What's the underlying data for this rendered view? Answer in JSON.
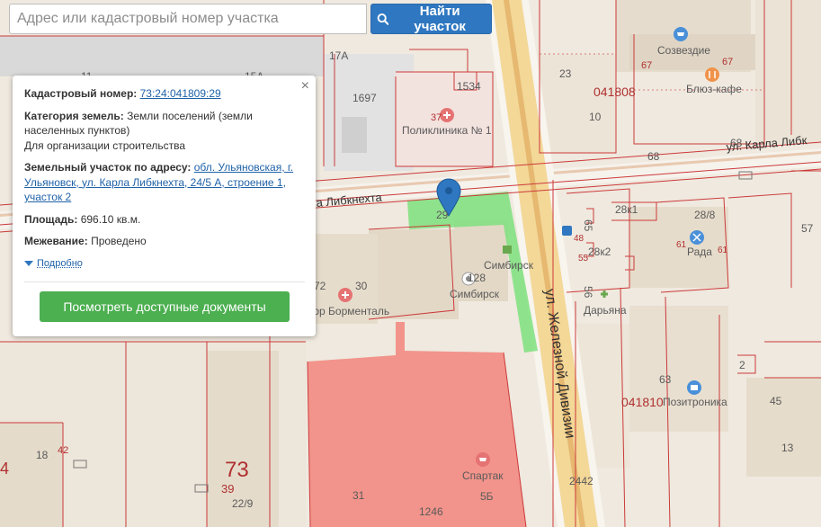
{
  "search": {
    "placeholder": "Адрес или кадастровый номер участка",
    "button_label": "Найти участок"
  },
  "popup": {
    "cadastral_label": "Кадастровый номер:",
    "cadastral_value": "73:24:041809:29",
    "category_label": "Категория земель:",
    "category_value": "Земли поселений (земли населенных пунктов)",
    "category_use": "Для организации строительства",
    "address_label": "Земельный участок по адресу:",
    "address_value": "обл. Ульяновская, г. Ульяновск, ул. Карла Либкнехта, 24/5 А, строение 1, участок 2",
    "area_label": "Площадь:",
    "area_value": "696.10 кв.м.",
    "survey_label": "Межевание:",
    "survey_value": "Проведено",
    "details_toggle": "Подробно",
    "docs_button": "Посмотреть доступные документы",
    "close_symbol": "×"
  },
  "map": {
    "streets": {
      "libknekhta_left": "а Либкнехта",
      "libknekhta_right": "ул. Карла Либк",
      "zheleznoy": "ул. Железной Дивизии"
    },
    "blocks": {
      "b1": "041808",
      "b2": "041810",
      "b3": "73"
    },
    "pois": {
      "sozvezdie": "Созвездие",
      "blyuz": "Блюз-кафе",
      "poliklinika": "Поликлиника № 1",
      "simbirsk_upper": "Симбирск",
      "simbirsk_lower": "Симбирск",
      "bormental": "тор Борменталь",
      "daryana": "Дарьяна",
      "rada": "Рада",
      "pozitronika": "Позитроника",
      "spartak": "Спартак"
    },
    "numbers": {
      "n11": "11",
      "n15a": "15А",
      "n17a": "17А",
      "n1697": "1697",
      "n1534": "1534",
      "n37": "37",
      "n23": "23",
      "n10": "10",
      "n67a": "67",
      "n67b": "67",
      "n68a": "68",
      "n68b": "68",
      "n29": "29",
      "n28k1": "28к1",
      "n28_8": "28/8",
      "n28k2": "28к2",
      "n61a": "61",
      "n61b": "61",
      "n57": "57",
      "n48": "48",
      "n55": "55",
      "n56": "56",
      "n128": "128",
      "n72": "72",
      "n30": "30",
      "n63": "63",
      "n2": "2",
      "n45": "45",
      "n13": "13",
      "n42": "42",
      "n18": "18",
      "n39": "39",
      "n22_9": "22/9",
      "n31": "31",
      "n1246": "1246",
      "n5b": "5Б",
      "n2442": "2442",
      "n4": "4",
      "n65": "65"
    }
  }
}
